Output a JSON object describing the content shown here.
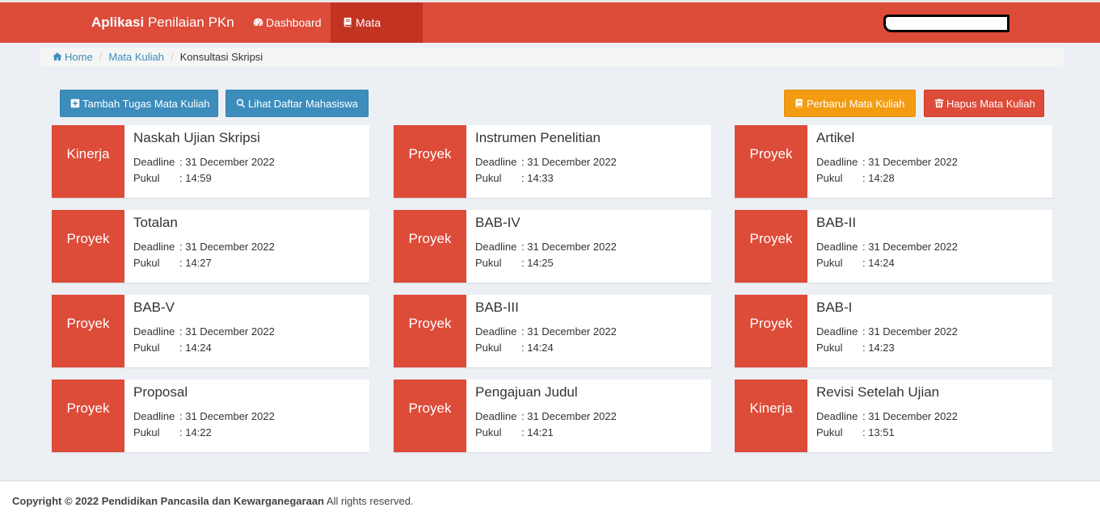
{
  "navbar": {
    "brand_bold": "Aplikasi",
    "brand_rest": "Penilaian PKn",
    "items": [
      {
        "label": "Dashboard",
        "icon": "dashboard-icon"
      },
      {
        "label": "Mata Kuliah",
        "icon": "book-icon"
      }
    ]
  },
  "breadcrumb": {
    "home": "Home",
    "parent": "Mata Kuliah",
    "current": "Konsultasi Skripsi"
  },
  "actions": {
    "add_task": "Tambah Tugas Mata Kuliah",
    "view_students": "Lihat Daftar Mahasiswa",
    "update_course": "Perbarui Mata Kuliah",
    "delete_course": "Hapus Mata Kuliah"
  },
  "labels": {
    "deadline": "Deadline",
    "time": "Pukul"
  },
  "tasks": [
    {
      "type": "Kinerja",
      "title": "Naskah Ujian Skripsi",
      "deadline": ": 31 December 2022",
      "time": ": 14:59"
    },
    {
      "type": "Proyek",
      "title": "Instrumen Penelitian",
      "deadline": ": 31 December 2022",
      "time": ": 14:33"
    },
    {
      "type": "Proyek",
      "title": "Artikel",
      "deadline": ": 31 December 2022",
      "time": ": 14:28"
    },
    {
      "type": "Proyek",
      "title": "Totalan",
      "deadline": ": 31 December 2022",
      "time": ": 14:27"
    },
    {
      "type": "Proyek",
      "title": "BAB-IV",
      "deadline": ": 31 December 2022",
      "time": ": 14:25"
    },
    {
      "type": "Proyek",
      "title": "BAB-II",
      "deadline": ": 31 December 2022",
      "time": ": 14:24"
    },
    {
      "type": "Proyek",
      "title": "BAB-V",
      "deadline": ": 31 December 2022",
      "time": ": 14:24"
    },
    {
      "type": "Proyek",
      "title": "BAB-III",
      "deadline": ": 31 December 2022",
      "time": ": 14:24"
    },
    {
      "type": "Proyek",
      "title": "BAB-I",
      "deadline": ": 31 December 2022",
      "time": ": 14:23"
    },
    {
      "type": "Proyek",
      "title": "Proposal",
      "deadline": ": 31 December 2022",
      "time": ": 14:22"
    },
    {
      "type": "Proyek",
      "title": "Pengajuan Judul",
      "deadline": ": 31 December 2022",
      "time": ": 14:21"
    },
    {
      "type": "Kinerja",
      "title": "Revisi Setelah Ujian",
      "deadline": ": 31 December 2022",
      "time": ": 13:51"
    }
  ],
  "footer": {
    "copyright": "Copyright © 2022 Pendidikan Pancasila dan Kewarganegaraan",
    "rights": "All rights reserved."
  },
  "colors": {
    "primary": "#dd4b39",
    "blue": "#3c8dbc",
    "orange": "#f39c12",
    "background": "#ecf0f5"
  }
}
